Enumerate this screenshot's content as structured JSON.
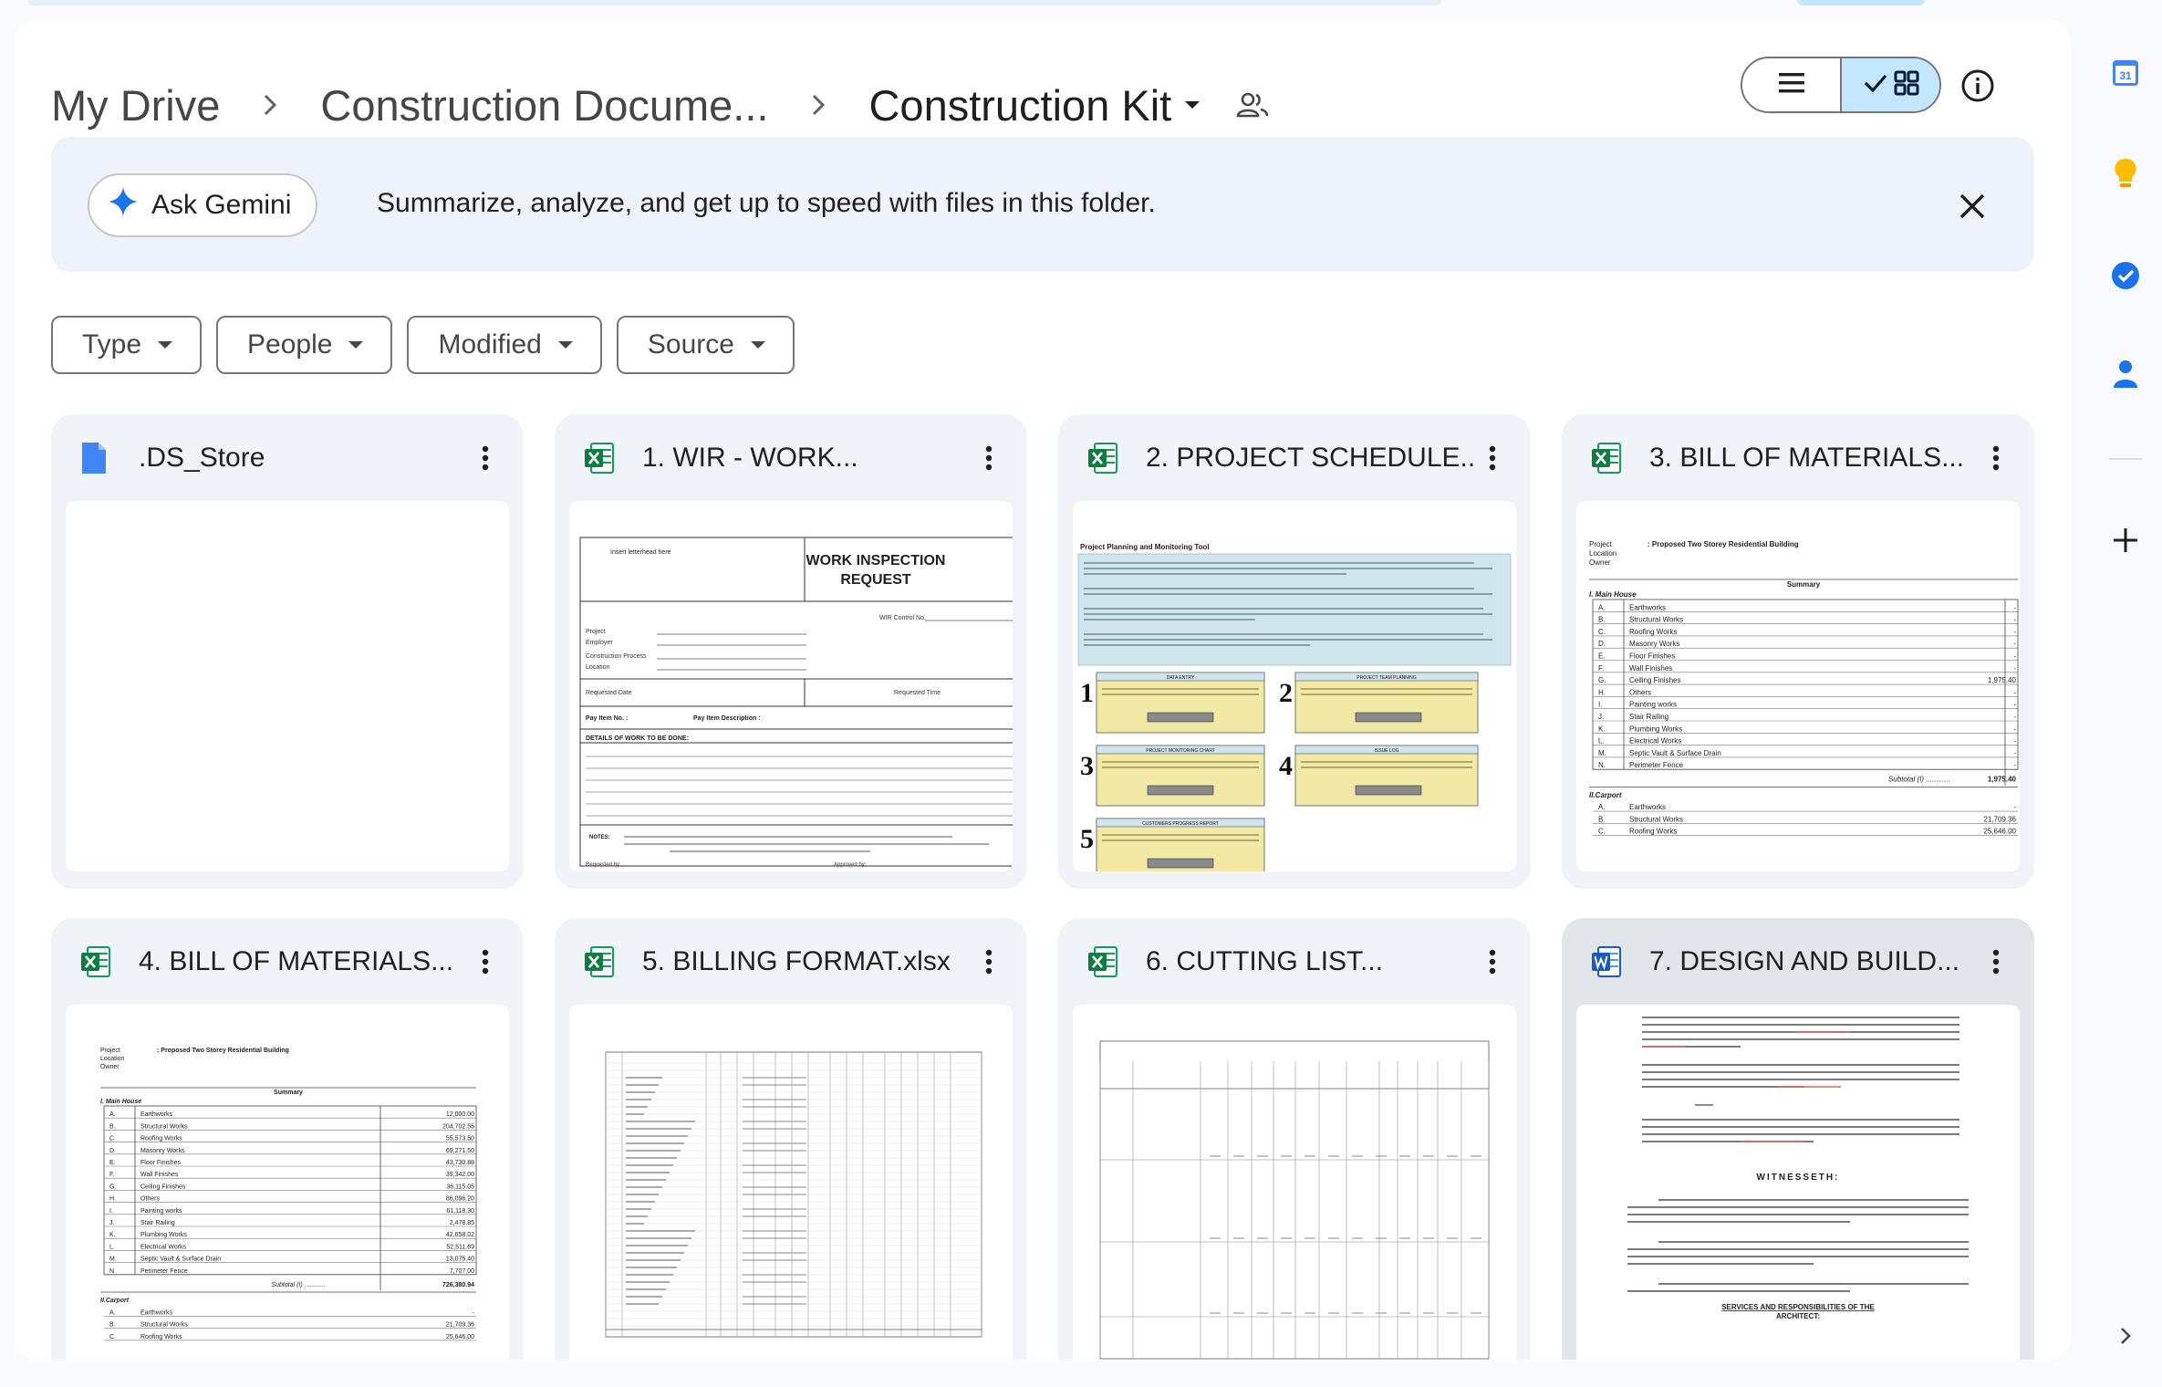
{
  "breadcrumbs": {
    "root": "My Drive",
    "parent": "Construction Docume...",
    "current": "Construction Kit"
  },
  "view": {
    "list_icon": "list-icon",
    "grid_icon": "grid-icon",
    "active": "grid"
  },
  "gemini": {
    "button_label": "Ask Gemini",
    "message": "Summarize, analyze, and get up to speed with files in this folder."
  },
  "filters": [
    {
      "label": "Type"
    },
    {
      "label": "People"
    },
    {
      "label": "Modified"
    },
    {
      "label": "Source"
    }
  ],
  "files": [
    {
      "name": ".DS_Store",
      "icon": "doc-file-icon"
    },
    {
      "name": "1. WIR - WORK...",
      "icon": "sheets-icon"
    },
    {
      "name": "2. PROJECT SCHEDULE...",
      "icon": "sheets-icon"
    },
    {
      "name": "3. BILL OF MATERIALS...",
      "icon": "sheets-icon"
    },
    {
      "name": "4. BILL OF MATERIALS...",
      "icon": "sheets-icon"
    },
    {
      "name": "5. BILLING FORMAT.xlsx",
      "icon": "sheets-icon"
    },
    {
      "name": "6. CUTTING LIST...",
      "icon": "sheets-icon"
    },
    {
      "name": "7. DESIGN AND BUILD...",
      "icon": "word-icon"
    }
  ],
  "thumbnails": {
    "wir": {
      "letterhead": "Insert letterhead here",
      "title_line1": "WORK INSPECTION",
      "title_line2": "REQUEST",
      "control": "WIR Control No.",
      "project": "Project",
      "employer": "Employer",
      "process": "Construction Process",
      "location": "Location",
      "req_date": "Requested Date",
      "req_time": "Requested Time",
      "pay_item": "Pay Item No. :",
      "pay_desc": "Pay Item Description :",
      "details": "DETAILS OF WORK TO BE DONE:",
      "notes": "NOTES:",
      "requested_by": "Requested by:",
      "approved_by": "Approved by:"
    },
    "schedule": {
      "title": "Project Planning and Monitoring Tool",
      "steps": [
        "1",
        "2",
        "3",
        "4",
        "5"
      ],
      "step_titles": [
        "DATA ENTRY",
        "PROJECT TEAM PLANNING",
        "PROJECT MONITORING CHART",
        "ISSUE LOG",
        "CUSTOMERS PROGRESS REPORT"
      ]
    },
    "bom3": {
      "project_label": "Project",
      "project_value": ": Proposed Two Storey Residential Building",
      "location_label": "Location",
      "owner_label": "Owner",
      "summary": "Summary",
      "section1": "I. Main House",
      "items": [
        [
          "A.",
          "Earthworks",
          "-"
        ],
        [
          "B.",
          "Structural Works",
          "-"
        ],
        [
          "C.",
          "Roofing Works",
          "-"
        ],
        [
          "D.",
          "Masonry Works",
          "-"
        ],
        [
          "E.",
          "Floor Finishes",
          "-"
        ],
        [
          "F.",
          "Wall Finishes",
          "-"
        ],
        [
          "G.",
          "Ceiling Finishes",
          "1,975.40"
        ],
        [
          "H.",
          "Others",
          "-"
        ],
        [
          "I.",
          "Painting works",
          "-"
        ],
        [
          "J.",
          "Stair Railing",
          "-"
        ],
        [
          "K.",
          "Plumbing Works",
          "-"
        ],
        [
          "L.",
          "Electrical Works",
          "-"
        ],
        [
          "M.",
          "Septic Vault & Surface Drain",
          "-"
        ],
        [
          "N.",
          "Perimeter Fence",
          "-"
        ]
      ],
      "subtotal_label": "Subtotal (I) ............",
      "subtotal": "1,975.40",
      "section2": "II.Carport",
      "items2": [
        [
          "A.",
          "Earthworks",
          "-"
        ],
        [
          "B.",
          "Structural Works",
          "21,709.36"
        ],
        [
          "C.",
          "Roofing Works",
          "25,646.00"
        ]
      ]
    },
    "bom4": {
      "project_label": "Project",
      "project_value": ": Proposed Two Storey Residential Building",
      "location_label": "Location",
      "owner_label": "Owner",
      "summary": "Summary",
      "section1": "I. Main House",
      "items": [
        [
          "A.",
          "Earthworks",
          "12,000.00"
        ],
        [
          "B.",
          "Structural Works",
          "204,702.55"
        ],
        [
          "C.",
          "Roofing Works",
          "55,573.50"
        ],
        [
          "D.",
          "Masonry Works",
          "69,271.50"
        ],
        [
          "E.",
          "Floor Finishes",
          "43,730.88"
        ],
        [
          "F.",
          "Wall Finishes",
          "39,342.00"
        ],
        [
          "G.",
          "Ceiling Finishes",
          "36,115.05"
        ],
        [
          "H.",
          "Others",
          "86,096.20"
        ],
        [
          "I.",
          "Painting works",
          "61,118.30"
        ],
        [
          "J.",
          "Stair Railing",
          "2,478.85"
        ],
        [
          "K.",
          "Plumbing Works",
          "42,658.02"
        ],
        [
          "L.",
          "Electrical Works",
          "52,511.69"
        ],
        [
          "M.",
          "Septic Vault & Surface Drain",
          "13,075.40"
        ],
        [
          "N.",
          "Perimeter Fence",
          "7,707.00"
        ]
      ],
      "subtotal_label": "Subtotal (I) ............",
      "subtotal": "726,380.94",
      "section2": "II.Carport",
      "items2": [
        [
          "A.",
          "Earthworks",
          "-"
        ],
        [
          "B.",
          "Structural Works",
          "21,709.36"
        ],
        [
          "C.",
          "Roofing Works",
          "25,646.00"
        ]
      ]
    },
    "design": {
      "witnesseth": "WITNESSETH:",
      "services": "SERVICES AND RESPONSIBILITIES OF THE",
      "architect": "ARCHITECT:"
    }
  },
  "rail": {
    "calendar_day": "31",
    "icons": [
      "calendar-icon",
      "keep-icon",
      "tasks-icon",
      "contacts-icon",
      "add-icon",
      "expand-icon"
    ]
  },
  "colors": {
    "accent": "#0b57d0",
    "selected": "#c2e7ff",
    "sheets": "#0f9d58",
    "word": "#185abd",
    "schedule_header": "#cfe6ee",
    "schedule_box": "#f1e9a5"
  }
}
